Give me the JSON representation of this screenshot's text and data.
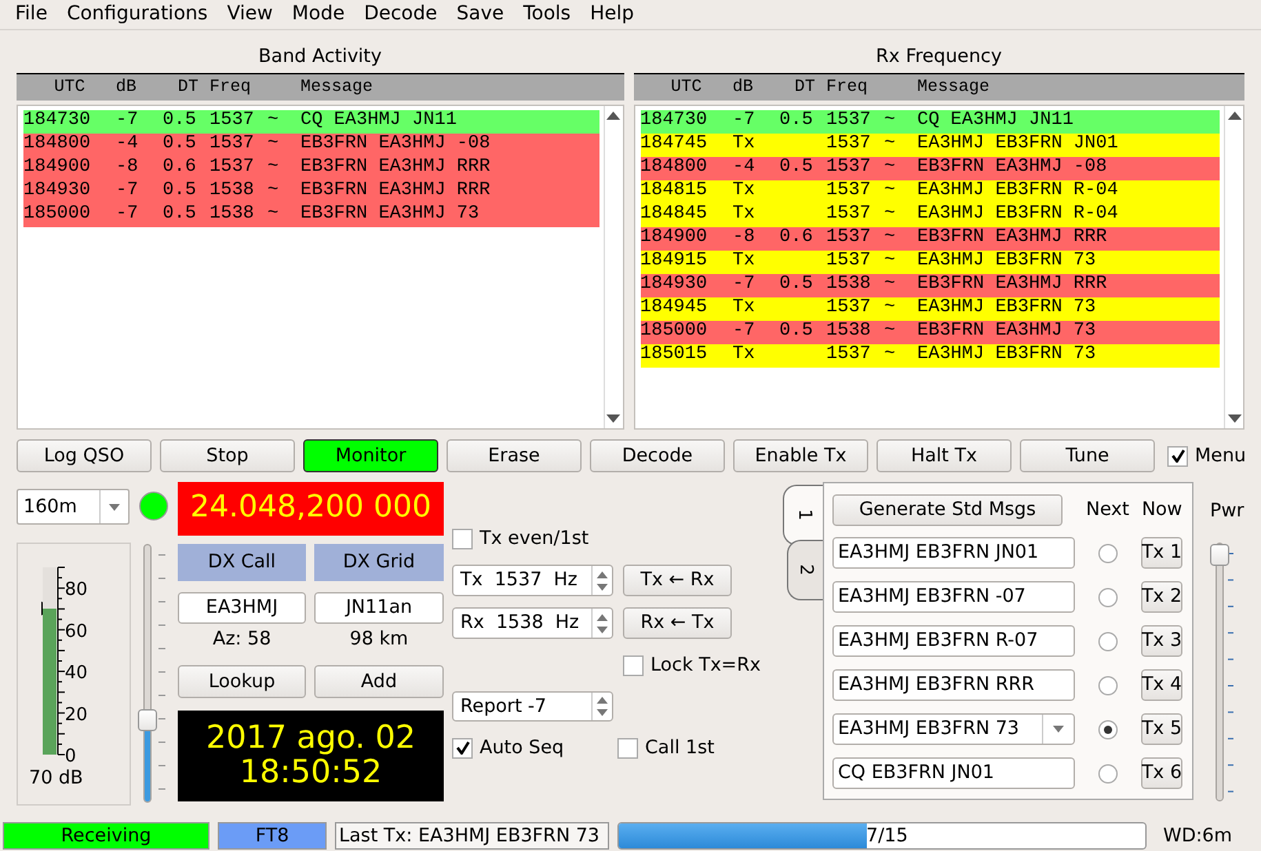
{
  "menu": [
    "File",
    "Configurations",
    "View",
    "Mode",
    "Decode",
    "Save",
    "Tools",
    "Help"
  ],
  "band_activity": {
    "title": "Band Activity",
    "columns": [
      "UTC",
      "dB",
      "DT",
      "Freq",
      "Message"
    ],
    "rows": [
      {
        "utc": "184730",
        "db": "-7",
        "dt": "0.5",
        "freq": "1537",
        "sep": "~",
        "message": "CQ EA3HMJ JN11",
        "color": "#66ff66"
      },
      {
        "utc": "184800",
        "db": "-4",
        "dt": "0.5",
        "freq": "1537",
        "sep": "~",
        "message": "EB3FRN EA3HMJ -08",
        "color": "#ff6666"
      },
      {
        "utc": "184900",
        "db": "-8",
        "dt": "0.6",
        "freq": "1537",
        "sep": "~",
        "message": "EB3FRN EA3HMJ RRR",
        "color": "#ff6666"
      },
      {
        "utc": "184930",
        "db": "-7",
        "dt": "0.5",
        "freq": "1538",
        "sep": "~",
        "message": "EB3FRN EA3HMJ RRR",
        "color": "#ff6666"
      },
      {
        "utc": "185000",
        "db": "-7",
        "dt": "0.5",
        "freq": "1538",
        "sep": "~",
        "message": "EB3FRN EA3HMJ 73",
        "color": "#ff6666"
      }
    ]
  },
  "rx_frequency": {
    "title": "Rx Frequency",
    "columns": [
      "UTC",
      "dB",
      "DT",
      "Freq",
      "Message"
    ],
    "rows": [
      {
        "utc": "184730",
        "db": "-7",
        "dt": "0.5",
        "freq": "1537",
        "sep": "~",
        "message": "CQ EA3HMJ JN11",
        "color": "#66ff66"
      },
      {
        "utc": "184745",
        "db": "Tx",
        "freq": "1537",
        "sep": "~",
        "message": "EA3HMJ EB3FRN JN01",
        "color": "#ffff00"
      },
      {
        "utc": "184800",
        "db": "-4",
        "dt": "0.5",
        "freq": "1537",
        "sep": "~",
        "message": "EB3FRN EA3HMJ -08",
        "color": "#ff6666"
      },
      {
        "utc": "184815",
        "db": "Tx",
        "freq": "1537",
        "sep": "~",
        "message": "EA3HMJ EB3FRN R-04",
        "color": "#ffff00"
      },
      {
        "utc": "184845",
        "db": "Tx",
        "freq": "1537",
        "sep": "~",
        "message": "EA3HMJ EB3FRN R-04",
        "color": "#ffff00"
      },
      {
        "utc": "184900",
        "db": "-8",
        "dt": "0.6",
        "freq": "1537",
        "sep": "~",
        "message": "EB3FRN EA3HMJ RRR",
        "color": "#ff6666"
      },
      {
        "utc": "184915",
        "db": "Tx",
        "freq": "1537",
        "sep": "~",
        "message": "EA3HMJ EB3FRN 73",
        "color": "#ffff00"
      },
      {
        "utc": "184930",
        "db": "-7",
        "dt": "0.5",
        "freq": "1538",
        "sep": "~",
        "message": "EB3FRN EA3HMJ RRR",
        "color": "#ff6666"
      },
      {
        "utc": "184945",
        "db": "Tx",
        "freq": "1537",
        "sep": "~",
        "message": "EA3HMJ EB3FRN 73",
        "color": "#ffff00"
      },
      {
        "utc": "185000",
        "db": "-7",
        "dt": "0.5",
        "freq": "1538",
        "sep": "~",
        "message": "EB3FRN EA3HMJ 73",
        "color": "#ff6666"
      },
      {
        "utc": "185015",
        "db": "Tx",
        "freq": "1537",
        "sep": "~",
        "message": "EA3HMJ EB3FRN 73",
        "color": "#ffff00"
      }
    ]
  },
  "buttons": [
    {
      "label": "Log QSO",
      "on": false
    },
    {
      "label": "Stop",
      "on": false
    },
    {
      "label": "Monitor",
      "on": true
    },
    {
      "label": "Erase",
      "on": false
    },
    {
      "label": "Decode",
      "on": false
    },
    {
      "label": "Enable Tx",
      "on": false
    },
    {
      "label": "Halt Tx",
      "on": false
    },
    {
      "label": "Tune",
      "on": false
    }
  ],
  "menu_toggle": {
    "label": "Menu",
    "checked": true
  },
  "band": {
    "value": "160m"
  },
  "status_led": {
    "on": true
  },
  "dial_frequency": "24.048,200 000",
  "meter": {
    "level": 0.78,
    "ticks": [
      "80",
      "60",
      "40",
      "20",
      "0"
    ],
    "reading": "70 dB"
  },
  "rx_slider": {
    "level": 0.3
  },
  "dx": {
    "call_label": "DX Call",
    "grid_label": "DX Grid",
    "call": "EA3HMJ",
    "grid": "JN11an",
    "azimuth": "Az: 58",
    "distance": "98 km",
    "lookup": "Lookup",
    "add": "Add"
  },
  "clock": {
    "date": "2017 ago. 02",
    "time": "18:50:52"
  },
  "tx_even": {
    "label": "Tx even/1st",
    "checked": false
  },
  "tx_freq": {
    "value": "Tx  1537  Hz",
    "button": "Tx ← Rx"
  },
  "rx_freq": {
    "value": "Rx  1538  Hz",
    "button": "Rx ← Tx"
  },
  "lock": {
    "label": "Lock Tx=Rx",
    "checked": false
  },
  "report": {
    "value": "Report -7"
  },
  "auto_seq": {
    "label": "Auto Seq",
    "checked": true
  },
  "call_1st": {
    "label": "Call 1st",
    "checked": false
  },
  "tabs": [
    {
      "label": "1",
      "selected": true
    },
    {
      "label": "2",
      "selected": false
    }
  ],
  "messages": {
    "generate": "Generate Std Msgs",
    "next_label": "Next",
    "now_label": "Now",
    "rows": [
      {
        "text": "EA3HMJ EB3FRN JN01",
        "kind": "field",
        "next": false,
        "button": "Tx 1"
      },
      {
        "text": "EA3HMJ EB3FRN -07",
        "kind": "field",
        "next": false,
        "button": "Tx 2"
      },
      {
        "text": "EA3HMJ EB3FRN R-07",
        "kind": "field",
        "next": false,
        "button": "Tx 3"
      },
      {
        "text": "EA3HMJ EB3FRN RRR",
        "kind": "field",
        "next": false,
        "button": "Tx 4"
      },
      {
        "text": "EA3HMJ EB3FRN 73",
        "kind": "combo",
        "next": true,
        "button": "Tx 5"
      },
      {
        "text": "CQ EB3FRN JN01",
        "kind": "field",
        "next": false,
        "button": "Tx 6"
      }
    ]
  },
  "power": {
    "label": "Pwr",
    "level": 1,
    "disabled": true
  },
  "status_bar": {
    "state": "Receiving",
    "mode": "FT8",
    "last_tx": "Last Tx: EA3HMJ EB3FRN 73",
    "progress": {
      "level": 0.47,
      "text": "7/15"
    },
    "watchdog": "WD:6m"
  }
}
